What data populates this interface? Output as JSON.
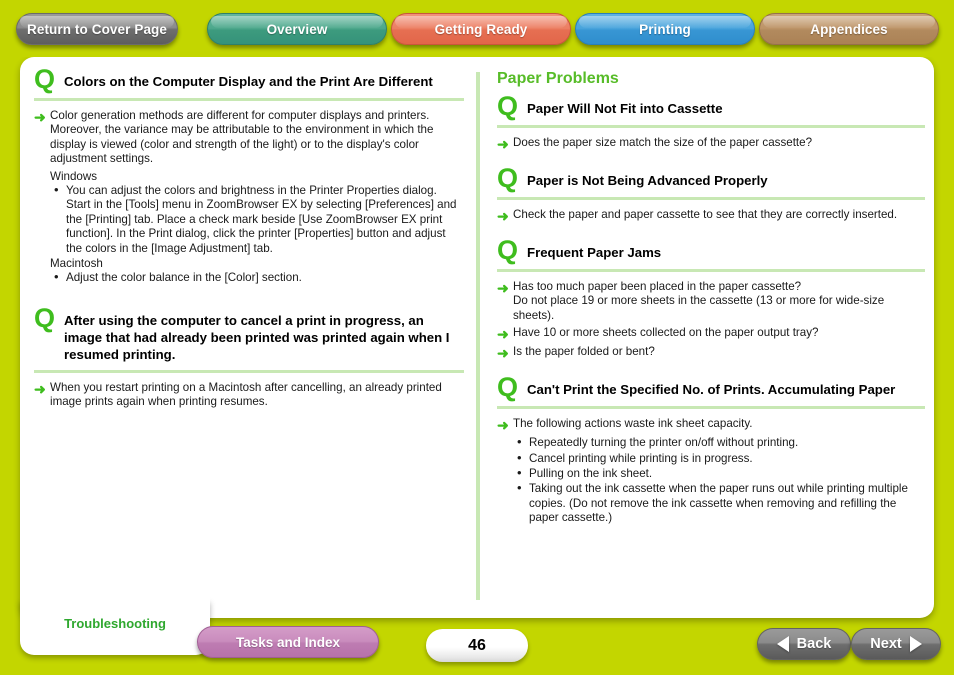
{
  "topnav": {
    "cover_label": "Return to Cover Page",
    "tabs": [
      {
        "label": "Overview",
        "color": "#4da88c"
      },
      {
        "label": "Getting Ready",
        "color": "#ec7f63"
      },
      {
        "label": "Printing",
        "color": "#3896d4"
      },
      {
        "label": "Appendices",
        "color": "#b28a5e"
      }
    ]
  },
  "left_column": {
    "q1": {
      "heading": "Colors on the Computer Display and the Print Are Different",
      "answer": "Color generation methods are different for computer displays and printers. Moreover, the variance may be attributable to the environment in which the display is viewed (color and strength of the light) or to the display's color adjustment settings.",
      "windows_label": "Windows",
      "windows_bullets": [
        "You can adjust the colors and brightness in the Printer Properties dialog. Start in the [Tools] menu in ZoomBrowser EX by selecting [Preferences] and the [Printing] tab. Place a check mark beside [Use ZoomBrowser EX print function]. In the Print dialog, click the printer [Properties] button and adjust the colors in the [Image Adjustment] tab."
      ],
      "macintosh_label": "Macintosh",
      "macintosh_bullets": [
        "Adjust the color balance in the [Color] section."
      ]
    },
    "q2": {
      "heading": "After using the computer to cancel a print in progress, an image that had already been printed was printed again when I resumed printing.",
      "answer": "When you restart printing on a Macintosh after cancelling, an already printed image prints again when printing resumes."
    }
  },
  "right_column": {
    "section_title": "Paper Problems",
    "q1": {
      "heading": "Paper Will Not Fit into Cassette",
      "answers": [
        "Does the paper size match the size of the paper cassette?"
      ]
    },
    "q2": {
      "heading": "Paper is Not Being Advanced Properly",
      "answers": [
        "Check the paper and paper cassette to see that they are correctly inserted."
      ]
    },
    "q3": {
      "heading": "Frequent Paper Jams",
      "answer1": "Has too much paper been placed in the paper cassette?",
      "answer1_cont": "Do not place 19 or more sheets in the cassette (13 or more for wide-size sheets).",
      "answer2": "Have 10 or more sheets collected on the paper output tray?",
      "answer3": "Is the paper folded or bent?"
    },
    "q4": {
      "heading": "Can't Print the Specified No. of Prints. Accumulating Paper",
      "answer": "The following actions waste ink sheet capacity.",
      "bullets": [
        "Repeatedly turning the printer on/off without printing.",
        "Cancel printing while printing is in progress.",
        "Pulling on the ink sheet.",
        "Taking out the ink cassette when the paper runs out while printing multiple copies. (Do not remove the ink cassette when removing and refilling the paper cassette.)"
      ]
    }
  },
  "footer": {
    "troubleshooting_label": "Troubleshooting",
    "tasks_label": "Tasks and Index",
    "page_number": "46",
    "back_label": "Back",
    "next_label": "Next"
  },
  "icons": {
    "q_mark": "Q",
    "arrow": "➜"
  },
  "colors": {
    "page_background": "#c3d600",
    "accent_green": "#3fbd1e",
    "rule_green": "#c8e8b4",
    "section_green": "#57bc28",
    "troubleshooting_green": "#2fa82f"
  }
}
